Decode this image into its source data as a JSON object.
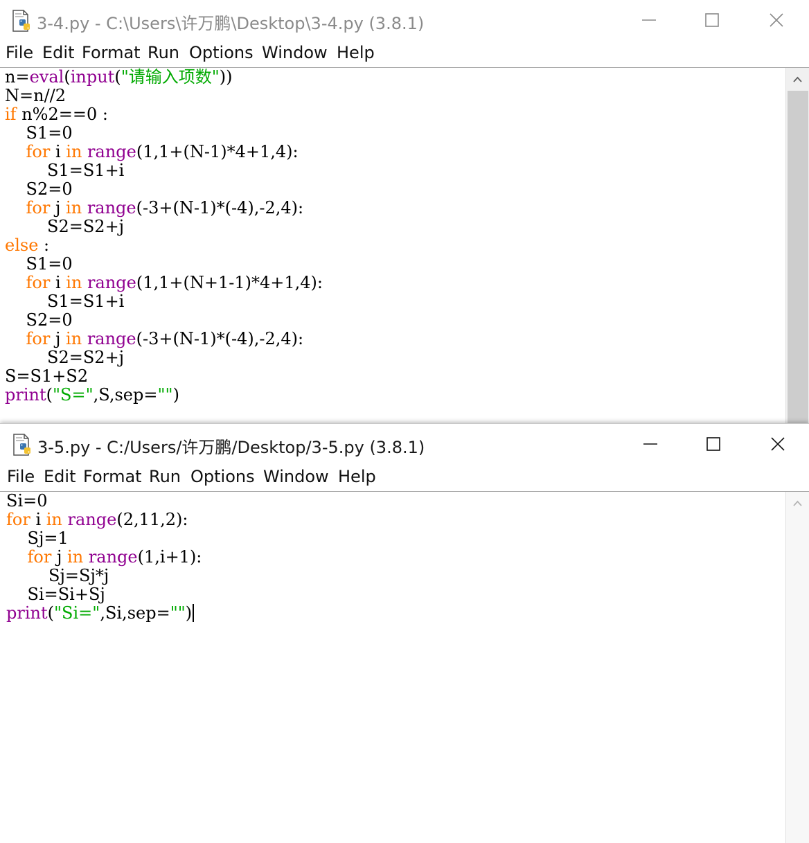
{
  "windows": [
    {
      "title": "3-4.py - C:\\Users\\许万鹏\\Desktop\\3-4.py (3.8.1)",
      "menu": [
        "File",
        "Edit",
        "Format",
        "Run",
        "Options",
        "Window",
        "Help"
      ],
      "code_lines": [
        [
          [
            "n=",
            ""
          ],
          [
            "eval",
            "bi"
          ],
          [
            "(",
            ""
          ],
          [
            "input",
            "bi"
          ],
          [
            "(",
            ""
          ],
          [
            "\"请输入项数\"",
            "st"
          ],
          [
            "))",
            ""
          ]
        ],
        [
          [
            "N=n//2",
            ""
          ]
        ],
        [
          [
            "if",
            "kw"
          ],
          [
            " n%2==0 :",
            ""
          ]
        ],
        [
          [
            "    S1=0",
            ""
          ]
        ],
        [
          [
            "    ",
            ""
          ],
          [
            "for",
            "kw"
          ],
          [
            " i ",
            ""
          ],
          [
            "in",
            "kw"
          ],
          [
            " ",
            ""
          ],
          [
            "range",
            "bi"
          ],
          [
            "(1,1+(N-1)*4+1,4):",
            ""
          ]
        ],
        [
          [
            "        S1=S1+i",
            ""
          ]
        ],
        [
          [
            "    S2=0",
            ""
          ]
        ],
        [
          [
            "    ",
            ""
          ],
          [
            "for",
            "kw"
          ],
          [
            " j ",
            ""
          ],
          [
            "in",
            "kw"
          ],
          [
            " ",
            ""
          ],
          [
            "range",
            "bi"
          ],
          [
            "(-3+(N-1)*(-4),-2,4):",
            ""
          ]
        ],
        [
          [
            "        S2=S2+j",
            ""
          ]
        ],
        [
          [
            "else",
            "kw"
          ],
          [
            " :",
            ""
          ]
        ],
        [
          [
            "    S1=0",
            ""
          ]
        ],
        [
          [
            "    ",
            ""
          ],
          [
            "for",
            "kw"
          ],
          [
            " i ",
            ""
          ],
          [
            "in",
            "kw"
          ],
          [
            " ",
            ""
          ],
          [
            "range",
            "bi"
          ],
          [
            "(1,1+(N+1-1)*4+1,4):",
            ""
          ]
        ],
        [
          [
            "        S1=S1+i",
            ""
          ]
        ],
        [
          [
            "    S2=0",
            ""
          ]
        ],
        [
          [
            "    ",
            ""
          ],
          [
            "for",
            "kw"
          ],
          [
            " j ",
            ""
          ],
          [
            "in",
            "kw"
          ],
          [
            " ",
            ""
          ],
          [
            "range",
            "bi"
          ],
          [
            "(-3+(N-1)*(-4),-2,4):",
            ""
          ]
        ],
        [
          [
            "        S2=S2+j",
            ""
          ]
        ],
        [
          [
            "S=S1+S2",
            ""
          ]
        ],
        [
          [
            "print",
            "bi"
          ],
          [
            "(",
            ""
          ],
          [
            "\"S=\"",
            "st"
          ],
          [
            ",S,sep=",
            ""
          ],
          [
            "\"\"",
            "st"
          ],
          [
            ")",
            ""
          ]
        ]
      ]
    },
    {
      "title": "3-5.py - C:/Users/许万鹏/Desktop/3-5.py (3.8.1)",
      "menu": [
        "File",
        "Edit",
        "Format",
        "Run",
        "Options",
        "Window",
        "Help"
      ],
      "code_lines": [
        [
          [
            "Si=0",
            ""
          ]
        ],
        [
          [
            "for",
            "kw"
          ],
          [
            " i ",
            ""
          ],
          [
            "in",
            "kw"
          ],
          [
            " ",
            ""
          ],
          [
            "range",
            "bi"
          ],
          [
            "(2,11,2):",
            ""
          ]
        ],
        [
          [
            "    Sj=1",
            ""
          ]
        ],
        [
          [
            "    ",
            ""
          ],
          [
            "for",
            "kw"
          ],
          [
            " j ",
            ""
          ],
          [
            "in",
            "kw"
          ],
          [
            " ",
            ""
          ],
          [
            "range",
            "bi"
          ],
          [
            "(1,i+1):",
            ""
          ]
        ],
        [
          [
            "        Sj=Sj*j",
            ""
          ]
        ],
        [
          [
            "    Si=Si+Sj",
            ""
          ]
        ],
        [
          [
            "print",
            "bi"
          ],
          [
            "(",
            ""
          ],
          [
            "\"Si=\"",
            "st"
          ],
          [
            ",Si,sep=",
            ""
          ],
          [
            "\"\"",
            "st"
          ],
          [
            ")",
            ""
          ]
        ]
      ]
    }
  ],
  "syntax_colors": {
    "keyword": "#ff7700",
    "builtin": "#900090",
    "string": "#00aa00",
    "default": "#000000"
  },
  "icons": {
    "app": "python-file-icon",
    "minimize": "minimize-icon",
    "maximize": "maximize-icon",
    "close": "close-icon",
    "scroll_up": "scroll-up-arrow-icon"
  }
}
